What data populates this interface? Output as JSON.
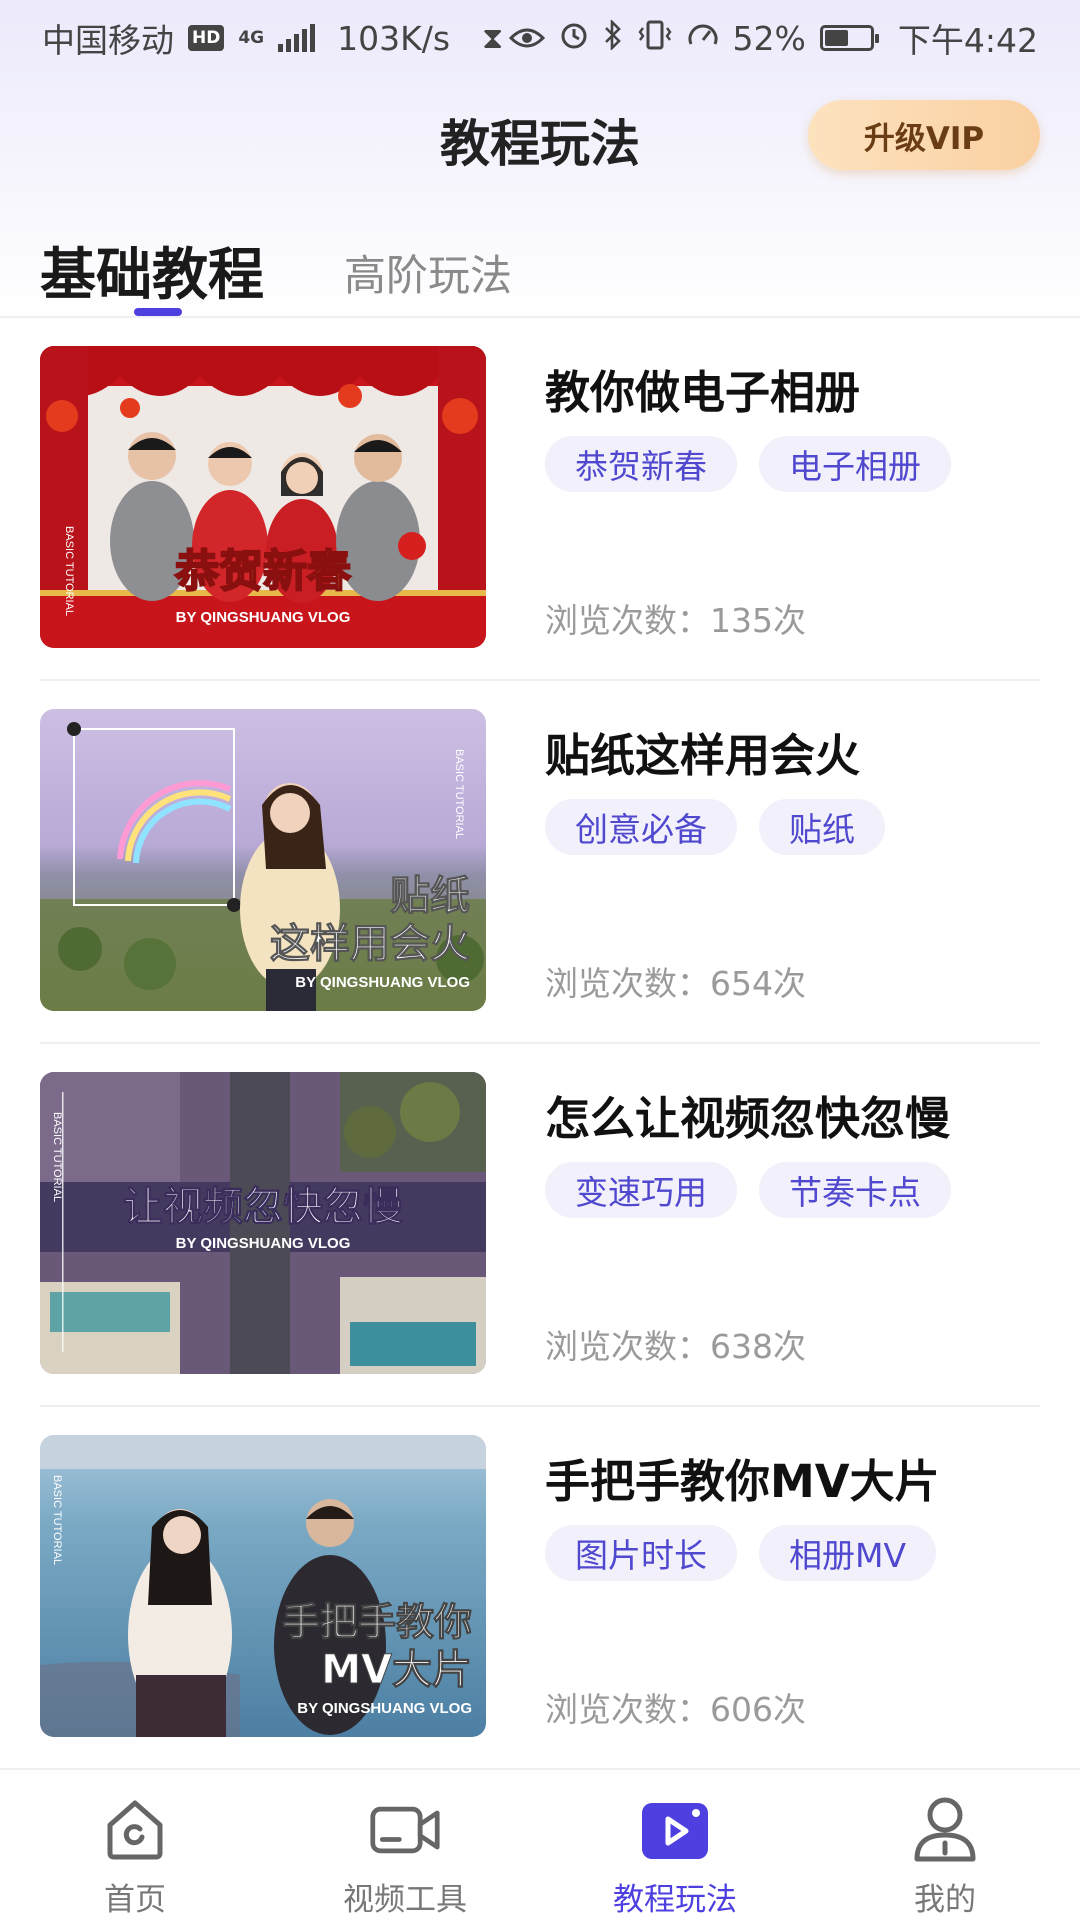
{
  "status_bar": {
    "carrier": "中国移动",
    "hd_badge": "HD",
    "network": "4G",
    "speed": "103K/s",
    "battery": "52%",
    "battery_level": 0.52,
    "time": "下午4:42"
  },
  "header": {
    "title": "教程玩法",
    "vip_button": "升级VIP"
  },
  "tabs": [
    {
      "label": "基础教程",
      "active": true
    },
    {
      "label": "高阶玩法",
      "active": false
    }
  ],
  "tutorials": [
    {
      "title": "教你做电子相册",
      "tags": [
        "恭贺新春",
        "电子相册"
      ],
      "views": "浏览次数：135次",
      "thumb_caption": "恭贺新春",
      "thumb_byline": "BY QINGSHUANG VLOG"
    },
    {
      "title": "贴纸这样用会火",
      "tags": [
        "创意必备",
        "贴纸"
      ],
      "views": "浏览次数：654次",
      "thumb_caption": "贴纸",
      "thumb_caption_2": "这样用会火",
      "thumb_byline": "BY QINGSHUANG VLOG"
    },
    {
      "title": "怎么让视频忽快忽慢",
      "tags": [
        "变速巧用",
        "节奏卡点"
      ],
      "views": "浏览次数：638次",
      "thumb_caption": "让视频忽快忽慢",
      "thumb_byline": "BY QINGSHUANG VLOG"
    },
    {
      "title": "手把手教你MV大片",
      "tags": [
        "图片时长",
        "相册MV"
      ],
      "views": "浏览次数：606次",
      "thumb_caption": "手把手教你",
      "thumb_caption_2": "MV大片",
      "thumb_byline": "BY QINGSHUANG VLOG"
    }
  ],
  "thumb_side_label": "BASIC TUTORIAL",
  "bottom_nav": [
    {
      "label": "首页",
      "icon": "home-icon",
      "active": false
    },
    {
      "label": "视频工具",
      "icon": "video-camera-icon",
      "active": false
    },
    {
      "label": "教程玩法",
      "icon": "play-tutorial-icon",
      "active": true
    },
    {
      "label": "我的",
      "icon": "profile-icon",
      "active": false
    }
  ],
  "colors": {
    "accent": "#4d3fe0",
    "tag_bg": "#f1f0fb",
    "tag_text": "#5048cf",
    "vip_gradient_start": "#fde2bf",
    "vip_gradient_end": "#fad0a1"
  }
}
